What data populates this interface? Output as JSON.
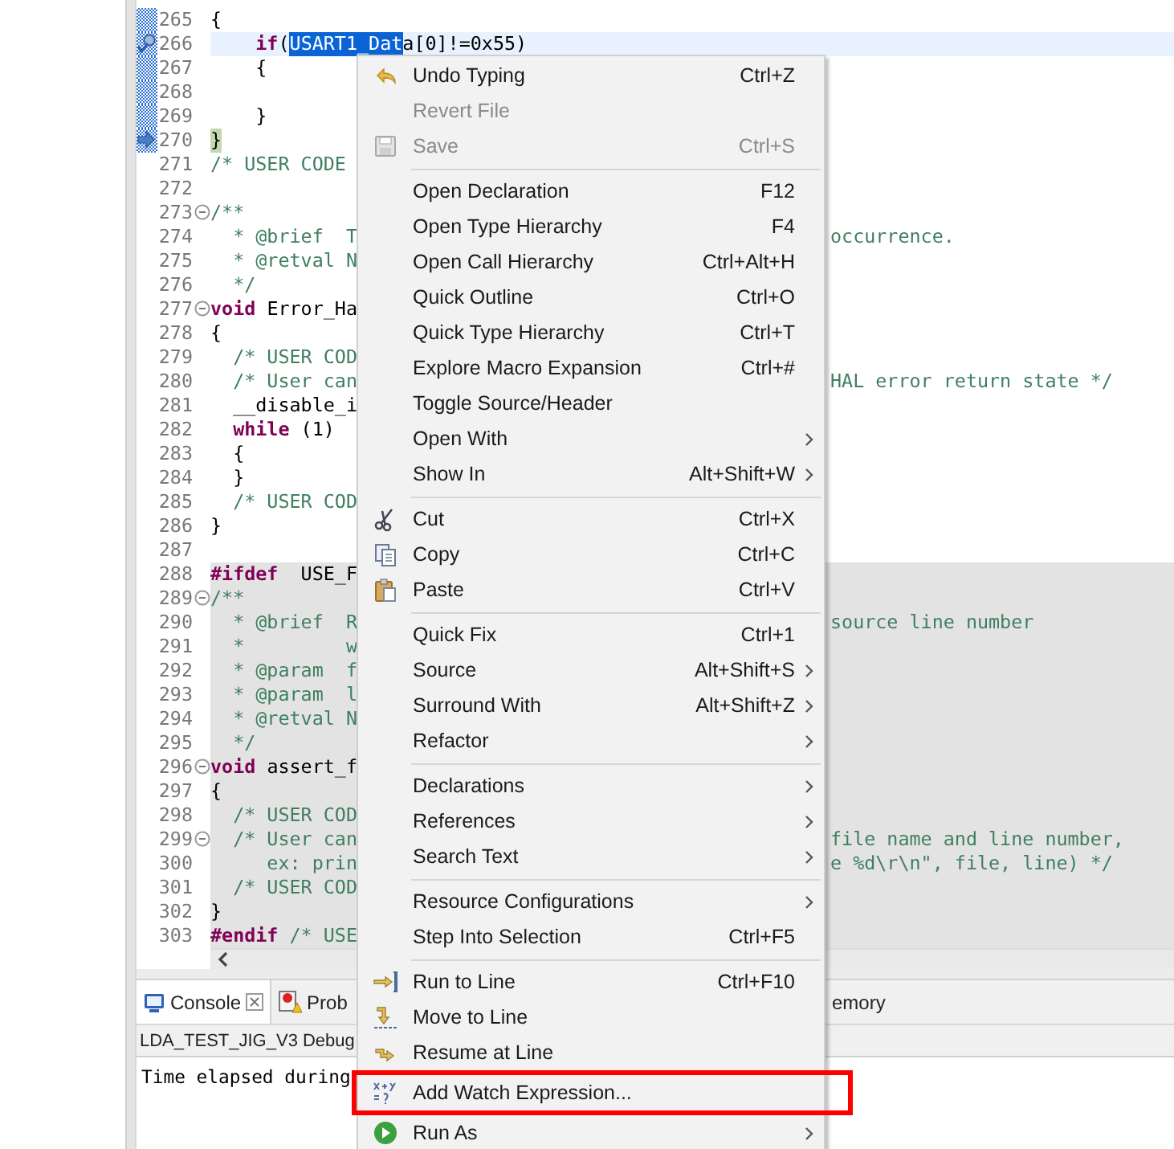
{
  "editor": {
    "lines": [
      {
        "number": "265",
        "kind": "plain",
        "changed": true,
        "current": false,
        "inactive": false,
        "fold": false,
        "code": [
          {
            "kind": "plain",
            "t": "{"
          }
        ]
      },
      {
        "number": "266",
        "kind": "watchpoint",
        "changed": true,
        "current": true,
        "inactive": false,
        "fold": false,
        "code": [
          {
            "kind": "keyword",
            "t": "    if"
          },
          {
            "kind": "plain",
            "t": "("
          },
          {
            "kind": "selection",
            "t": "USART1_Dat"
          },
          {
            "kind": "plain",
            "t": "a[0]!=0x55)"
          }
        ]
      },
      {
        "number": "267",
        "kind": "plain",
        "changed": true,
        "current": false,
        "inactive": false,
        "fold": false,
        "code": [
          {
            "kind": "plain",
            "t": "    {"
          }
        ]
      },
      {
        "number": "268",
        "kind": "plain",
        "changed": true,
        "current": false,
        "inactive": false,
        "fold": false
      },
      {
        "number": "269",
        "kind": "plain",
        "changed": true,
        "current": false,
        "inactive": false,
        "fold": false,
        "code": [
          {
            "kind": "plain",
            "t": "    }"
          }
        ]
      },
      {
        "number": "270",
        "kind": "pointer",
        "changed": true,
        "current": false,
        "inactive": false,
        "fold": false,
        "code": [
          {
            "kind": "match",
            "t": "}"
          }
        ]
      },
      {
        "number": "271",
        "kind": "plain",
        "changed": false,
        "current": false,
        "inactive": false,
        "fold": false,
        "code": [
          {
            "kind": "comment",
            "t": "/* USER CODE"
          }
        ]
      },
      {
        "number": "272",
        "kind": "plain",
        "changed": false,
        "current": false,
        "inactive": false,
        "fold": false
      },
      {
        "number": "273",
        "kind": "plain",
        "changed": false,
        "current": false,
        "inactive": false,
        "fold": true,
        "code": [
          {
            "kind": "comment",
            "t": "/**"
          }
        ]
      },
      {
        "number": "274",
        "kind": "plain",
        "changed": false,
        "current": false,
        "inactive": false,
        "fold": false,
        "code": [
          {
            "kind": "comment",
            "t": "  * @brief  T"
          }
        ],
        "tail": "occurrence."
      },
      {
        "number": "275",
        "kind": "plain",
        "changed": false,
        "current": false,
        "inactive": false,
        "fold": false,
        "code": [
          {
            "kind": "comment",
            "t": "  * @retval N"
          }
        ]
      },
      {
        "number": "276",
        "kind": "plain",
        "changed": false,
        "current": false,
        "inactive": false,
        "fold": false,
        "code": [
          {
            "kind": "comment",
            "t": "  */"
          }
        ]
      },
      {
        "number": "277",
        "kind": "plain",
        "changed": false,
        "current": false,
        "inactive": false,
        "fold": true,
        "code": [
          {
            "kind": "keyword",
            "t": "void"
          },
          {
            "kind": "plain",
            "t": " Error_Ha"
          }
        ]
      },
      {
        "number": "278",
        "kind": "plain",
        "changed": false,
        "current": false,
        "inactive": false,
        "fold": false,
        "code": [
          {
            "kind": "plain",
            "t": "{"
          }
        ]
      },
      {
        "number": "279",
        "kind": "plain",
        "changed": false,
        "current": false,
        "inactive": false,
        "fold": false,
        "code": [
          {
            "kind": "comment",
            "t": "  /* USER COD"
          }
        ]
      },
      {
        "number": "280",
        "kind": "plain",
        "changed": false,
        "current": false,
        "inactive": false,
        "fold": false,
        "code": [
          {
            "kind": "comment",
            "t": "  /* User can"
          }
        ],
        "tail": "HAL error return state */"
      },
      {
        "number": "281",
        "kind": "plain",
        "changed": false,
        "current": false,
        "inactive": false,
        "fold": false,
        "code": [
          {
            "kind": "plain",
            "t": "  __disable_i"
          }
        ]
      },
      {
        "number": "282",
        "kind": "plain",
        "changed": false,
        "current": false,
        "inactive": false,
        "fold": false,
        "code": [
          {
            "kind": "keyword",
            "t": "  while"
          },
          {
            "kind": "plain",
            "t": " (1)"
          }
        ]
      },
      {
        "number": "283",
        "kind": "plain",
        "changed": false,
        "current": false,
        "inactive": false,
        "fold": false,
        "code": [
          {
            "kind": "plain",
            "t": "  {"
          }
        ]
      },
      {
        "number": "284",
        "kind": "plain",
        "changed": false,
        "current": false,
        "inactive": false,
        "fold": false,
        "code": [
          {
            "kind": "plain",
            "t": "  }"
          }
        ]
      },
      {
        "number": "285",
        "kind": "plain",
        "changed": false,
        "current": false,
        "inactive": false,
        "fold": false,
        "code": [
          {
            "kind": "comment",
            "t": "  /* USER COD"
          }
        ]
      },
      {
        "number": "286",
        "kind": "plain",
        "changed": false,
        "current": false,
        "inactive": false,
        "fold": false,
        "code": [
          {
            "kind": "plain",
            "t": "}"
          }
        ]
      },
      {
        "number": "287",
        "kind": "plain",
        "changed": false,
        "current": false,
        "inactive": false,
        "fold": false
      },
      {
        "number": "288",
        "kind": "plain",
        "changed": false,
        "current": false,
        "inactive": true,
        "fold": false,
        "code": [
          {
            "kind": "keyword",
            "t": "#ifdef"
          },
          {
            "kind": "plain",
            "t": "  USE_F"
          }
        ]
      },
      {
        "number": "289",
        "kind": "plain",
        "changed": false,
        "current": false,
        "inactive": true,
        "fold": true,
        "code": [
          {
            "kind": "comment",
            "t": "/**"
          }
        ]
      },
      {
        "number": "290",
        "kind": "plain",
        "changed": false,
        "current": false,
        "inactive": true,
        "fold": false,
        "code": [
          {
            "kind": "comment",
            "t": "  * @brief  R"
          }
        ],
        "tail": "source line number"
      },
      {
        "number": "291",
        "kind": "plain",
        "changed": false,
        "current": false,
        "inactive": true,
        "fold": false,
        "code": [
          {
            "kind": "comment",
            "t": "  *         w"
          }
        ]
      },
      {
        "number": "292",
        "kind": "plain",
        "changed": false,
        "current": false,
        "inactive": true,
        "fold": false,
        "code": [
          {
            "kind": "comment",
            "t": "  * @param  f"
          }
        ]
      },
      {
        "number": "293",
        "kind": "plain",
        "changed": false,
        "current": false,
        "inactive": true,
        "fold": false,
        "code": [
          {
            "kind": "comment",
            "t": "  * @param  l"
          }
        ]
      },
      {
        "number": "294",
        "kind": "plain",
        "changed": false,
        "current": false,
        "inactive": true,
        "fold": false,
        "code": [
          {
            "kind": "comment",
            "t": "  * @retval N"
          }
        ]
      },
      {
        "number": "295",
        "kind": "plain",
        "changed": false,
        "current": false,
        "inactive": true,
        "fold": false,
        "code": [
          {
            "kind": "comment",
            "t": "  */"
          }
        ]
      },
      {
        "number": "296",
        "kind": "plain",
        "changed": false,
        "current": false,
        "inactive": true,
        "fold": true,
        "code": [
          {
            "kind": "keyword",
            "t": "void"
          },
          {
            "kind": "plain",
            "t": " assert_f"
          }
        ]
      },
      {
        "number": "297",
        "kind": "plain",
        "changed": false,
        "current": false,
        "inactive": true,
        "fold": false,
        "code": [
          {
            "kind": "plain",
            "t": "{"
          }
        ]
      },
      {
        "number": "298",
        "kind": "plain",
        "changed": false,
        "current": false,
        "inactive": true,
        "fold": false,
        "code": [
          {
            "kind": "comment",
            "t": "  /* USER COD"
          }
        ]
      },
      {
        "number": "299",
        "kind": "plain",
        "changed": false,
        "current": false,
        "inactive": true,
        "fold": true,
        "code": [
          {
            "kind": "comment",
            "t": "  /* User can"
          }
        ],
        "tail": "file name and line number,"
      },
      {
        "number": "300",
        "kind": "plain",
        "changed": false,
        "current": false,
        "inactive": true,
        "fold": false,
        "code": [
          {
            "kind": "comment",
            "t": "     ex: prin"
          }
        ],
        "tail": "e %d\\r\\n\", file, line) */"
      },
      {
        "number": "301",
        "kind": "plain",
        "changed": false,
        "current": false,
        "inactive": true,
        "fold": false,
        "code": [
          {
            "kind": "comment",
            "t": "  /* USER COD"
          }
        ]
      },
      {
        "number": "302",
        "kind": "plain",
        "changed": false,
        "current": false,
        "inactive": true,
        "fold": false,
        "code": [
          {
            "kind": "plain",
            "t": "}"
          }
        ]
      },
      {
        "number": "303",
        "kind": "plain",
        "changed": false,
        "current": false,
        "inactive": true,
        "fold": false,
        "code": [
          {
            "kind": "keyword",
            "t": "#endif"
          },
          {
            "kind": "comment",
            "t": " /* USE"
          }
        ]
      }
    ]
  },
  "bottom_panel": {
    "tabs": [
      {
        "label": "Console",
        "closable": true,
        "selected": true
      },
      {
        "label": "Prob",
        "closable": false,
        "selected": false
      },
      {
        "label": "emory",
        "closable": false,
        "selected": false
      }
    ],
    "title": "LDA_TEST_JIG_V3 Debug",
    "output": "Time elapsed during"
  },
  "context_menu": {
    "items": [
      {
        "kind": "item",
        "label": "Undo Typing",
        "shortcut": "Ctrl+Z",
        "disabled": false,
        "submenu": false,
        "highlighted": false
      },
      {
        "kind": "item",
        "label": "Revert File",
        "disabled": true,
        "submenu": false,
        "highlighted": false
      },
      {
        "kind": "item",
        "label": "Save",
        "shortcut": "Ctrl+S",
        "disabled": true,
        "submenu": false,
        "highlighted": false
      },
      {
        "kind": "separator"
      },
      {
        "kind": "item",
        "label": "Open Declaration",
        "shortcut": "F12",
        "disabled": false,
        "submenu": false,
        "highlighted": false
      },
      {
        "kind": "item",
        "label": "Open Type Hierarchy",
        "shortcut": "F4",
        "disabled": false,
        "submenu": false,
        "highlighted": false
      },
      {
        "kind": "item",
        "label": "Open Call Hierarchy",
        "shortcut": "Ctrl+Alt+H",
        "disabled": false,
        "submenu": false,
        "highlighted": false
      },
      {
        "kind": "item",
        "label": "Quick Outline",
        "shortcut": "Ctrl+O",
        "disabled": false,
        "submenu": false,
        "highlighted": false
      },
      {
        "kind": "item",
        "label": "Quick Type Hierarchy",
        "shortcut": "Ctrl+T",
        "disabled": false,
        "submenu": false,
        "highlighted": false
      },
      {
        "kind": "item",
        "label": "Explore Macro Expansion",
        "shortcut": "Ctrl+#",
        "disabled": false,
        "submenu": false,
        "highlighted": false
      },
      {
        "kind": "item",
        "label": "Toggle Source/Header",
        "disabled": false,
        "submenu": false,
        "highlighted": false
      },
      {
        "kind": "item",
        "label": "Open With",
        "disabled": false,
        "submenu": true,
        "highlighted": false
      },
      {
        "kind": "item",
        "label": "Show In",
        "shortcut": "Alt+Shift+W",
        "disabled": false,
        "submenu": true,
        "highlighted": false
      },
      {
        "kind": "separator"
      },
      {
        "kind": "item",
        "label": "Cut",
        "shortcut": "Ctrl+X",
        "disabled": false,
        "submenu": false,
        "highlighted": false
      },
      {
        "kind": "item",
        "label": "Copy",
        "shortcut": "Ctrl+C",
        "disabled": false,
        "submenu": false,
        "highlighted": false
      },
      {
        "kind": "item",
        "label": "Paste",
        "shortcut": "Ctrl+V",
        "disabled": false,
        "submenu": false,
        "highlighted": false
      },
      {
        "kind": "separator"
      },
      {
        "kind": "item",
        "label": "Quick Fix",
        "shortcut": "Ctrl+1",
        "disabled": false,
        "submenu": false,
        "highlighted": false
      },
      {
        "kind": "item",
        "label": "Source",
        "shortcut": "Alt+Shift+S",
        "disabled": false,
        "submenu": true,
        "highlighted": false
      },
      {
        "kind": "item",
        "label": "Surround With",
        "shortcut": "Alt+Shift+Z",
        "disabled": false,
        "submenu": true,
        "highlighted": false
      },
      {
        "kind": "item",
        "label": "Refactor",
        "disabled": false,
        "submenu": true,
        "highlighted": false
      },
      {
        "kind": "separator"
      },
      {
        "kind": "item",
        "label": "Declarations",
        "disabled": false,
        "submenu": true,
        "highlighted": false
      },
      {
        "kind": "item",
        "label": "References",
        "disabled": false,
        "submenu": true,
        "highlighted": false
      },
      {
        "kind": "item",
        "label": "Search Text",
        "disabled": false,
        "submenu": true,
        "highlighted": false
      },
      {
        "kind": "separator"
      },
      {
        "kind": "item",
        "label": "Resource Configurations",
        "disabled": false,
        "submenu": true,
        "highlighted": false
      },
      {
        "kind": "item",
        "label": "Step Into Selection",
        "shortcut": "Ctrl+F5",
        "disabled": false,
        "submenu": false,
        "highlighted": false
      },
      {
        "kind": "separator"
      },
      {
        "kind": "item",
        "label": "Run to Line",
        "shortcut": "Ctrl+F10",
        "disabled": false,
        "submenu": false,
        "highlighted": false
      },
      {
        "kind": "item",
        "label": "Move to Line",
        "disabled": false,
        "submenu": false,
        "highlighted": false
      },
      {
        "kind": "item",
        "label": "Resume at Line",
        "disabled": false,
        "submenu": false,
        "highlighted": false
      },
      {
        "kind": "item",
        "label": "Add Watch Expression...",
        "disabled": false,
        "submenu": false,
        "highlighted": true
      },
      {
        "kind": "item",
        "label": "Run As",
        "disabled": false,
        "submenu": true,
        "highlighted": false
      }
    ]
  }
}
